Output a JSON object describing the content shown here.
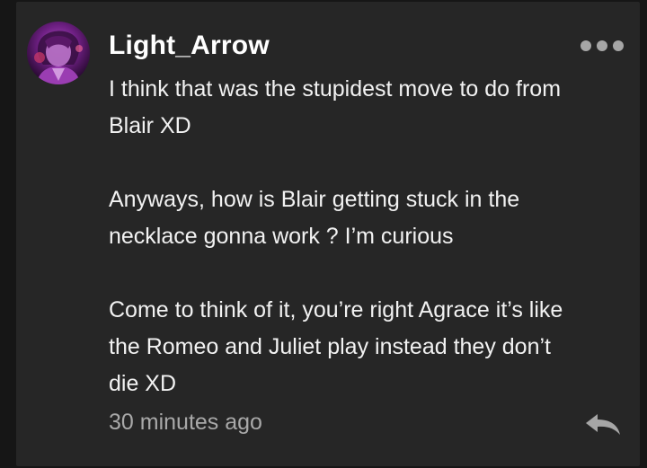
{
  "comment": {
    "username": "Light_Arrow",
    "avatar_icon": "avatar-image",
    "more_icon": "more-options-icon",
    "paragraphs": [
      [
        "I think that was the stupidest move to do from",
        "Blair XD"
      ],
      [
        "Anyways, how is Blair getting stuck in the",
        "necklace gonna work ? I’m curious"
      ],
      [
        "Come to think of it, you’re right Agrace it’s like",
        "the Romeo and Juliet play instead they don’t",
        "die XD"
      ]
    ],
    "timestamp": "30 minutes ago",
    "reply_icon": "reply-icon"
  },
  "colors": {
    "background": "#161616",
    "card": "#262626",
    "text": "#f2f2f2",
    "muted": "#a9a9a9",
    "avatar_accent": "#8e2aa8"
  }
}
